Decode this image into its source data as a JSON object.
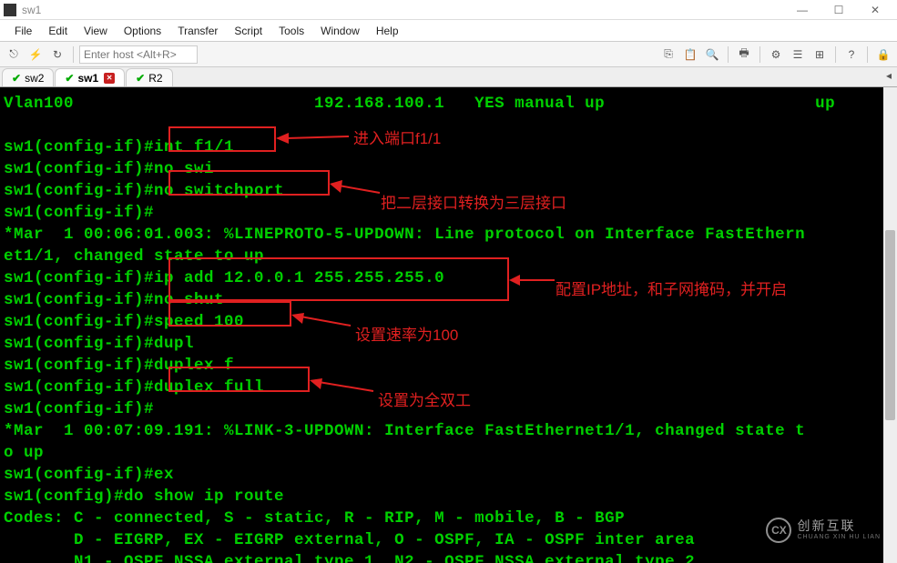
{
  "window": {
    "title": "sw1",
    "minimize": "—",
    "maximize": "☐",
    "close": "✕"
  },
  "menu": {
    "file": "File",
    "edit": "Edit",
    "view": "View",
    "options": "Options",
    "transfer": "Transfer",
    "script": "Script",
    "tools": "Tools",
    "window": "Window",
    "help": "Help"
  },
  "toolbar": {
    "host_placeholder": "Enter host <Alt+R>"
  },
  "tabs": [
    {
      "label": "sw2",
      "active": false,
      "closeable": false
    },
    {
      "label": "sw1",
      "active": true,
      "closeable": true
    },
    {
      "label": "R2",
      "active": false,
      "closeable": false
    }
  ],
  "terminal_lines": [
    "Vlan100                        192.168.100.1   YES manual up                     up",
    "",
    "sw1(config-if)#int f1/1",
    "sw1(config-if)#no swi",
    "sw1(config-if)#no switchport",
    "sw1(config-if)#",
    "*Mar  1 00:06:01.003: %LINEPROTO-5-UPDOWN: Line protocol on Interface FastEthern",
    "et1/1, changed state to up",
    "sw1(config-if)#ip add 12.0.0.1 255.255.255.0",
    "sw1(config-if)#no shut",
    "sw1(config-if)#speed 100",
    "sw1(config-if)#dupl",
    "sw1(config-if)#duplex f",
    "sw1(config-if)#duplex full",
    "sw1(config-if)#",
    "*Mar  1 00:07:09.191: %LINK-3-UPDOWN: Interface FastEthernet1/1, changed state t",
    "o up",
    "sw1(config-if)#ex",
    "sw1(config)#do show ip route",
    "Codes: C - connected, S - static, R - RIP, M - mobile, B - BGP",
    "       D - EIGRP, EX - EIGRP external, O - OSPF, IA - OSPF inter area ",
    "       N1 - OSPF NSSA external type 1, N2 - OSPF NSSA external type 2"
  ],
  "annotations": [
    {
      "label": "进入端口f1/1"
    },
    {
      "label": "把二层接口转换为三层接口"
    },
    {
      "label": "配置IP地址，和子网掩码，并开启"
    },
    {
      "label": "设置速率为100"
    },
    {
      "label": "设置为全双工"
    }
  ],
  "watermark": {
    "cn": "创新互联",
    "en": "CHUANG XIN HU LIAN"
  }
}
